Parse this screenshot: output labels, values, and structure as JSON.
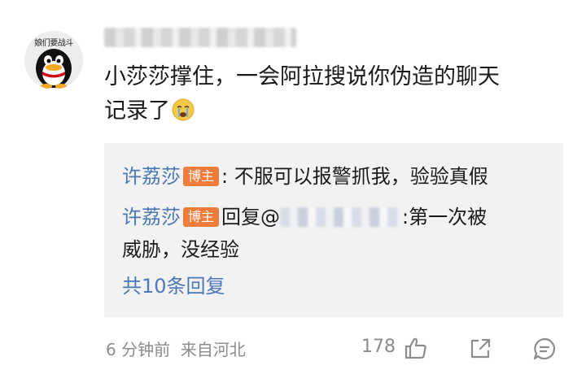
{
  "comment": {
    "avatar_caption": "娘们要战斗",
    "avatar_icon": "penguin-avatar-icon",
    "text_line1": "小莎莎撑住，一会阿拉搜说你伪造的聊天",
    "text_line2": "记录了",
    "emoji": "crying-emoji-icon"
  },
  "replies": {
    "items": [
      {
        "author": "许荔莎",
        "badge": "博主",
        "text": ": 不服可以报警抓我，验验真假"
      },
      {
        "author": "许荔莎",
        "badge": "博主",
        "reply_prefix": "回复@",
        "text_after_mention": ":第一次被",
        "text_line2": "威胁，没经验"
      }
    ],
    "more_label": "共10条回复"
  },
  "footer": {
    "time": "6 分钟前",
    "location": "来自河北",
    "like_count": "178",
    "icons": [
      "thumbs-up-icon",
      "share-icon",
      "comment-icon"
    ]
  },
  "colors": {
    "link_blue": "#4b77b7",
    "badge_orange": "#f07c3c",
    "reply_bg": "#f2f2f2",
    "meta_gray": "#8c8c8c"
  }
}
